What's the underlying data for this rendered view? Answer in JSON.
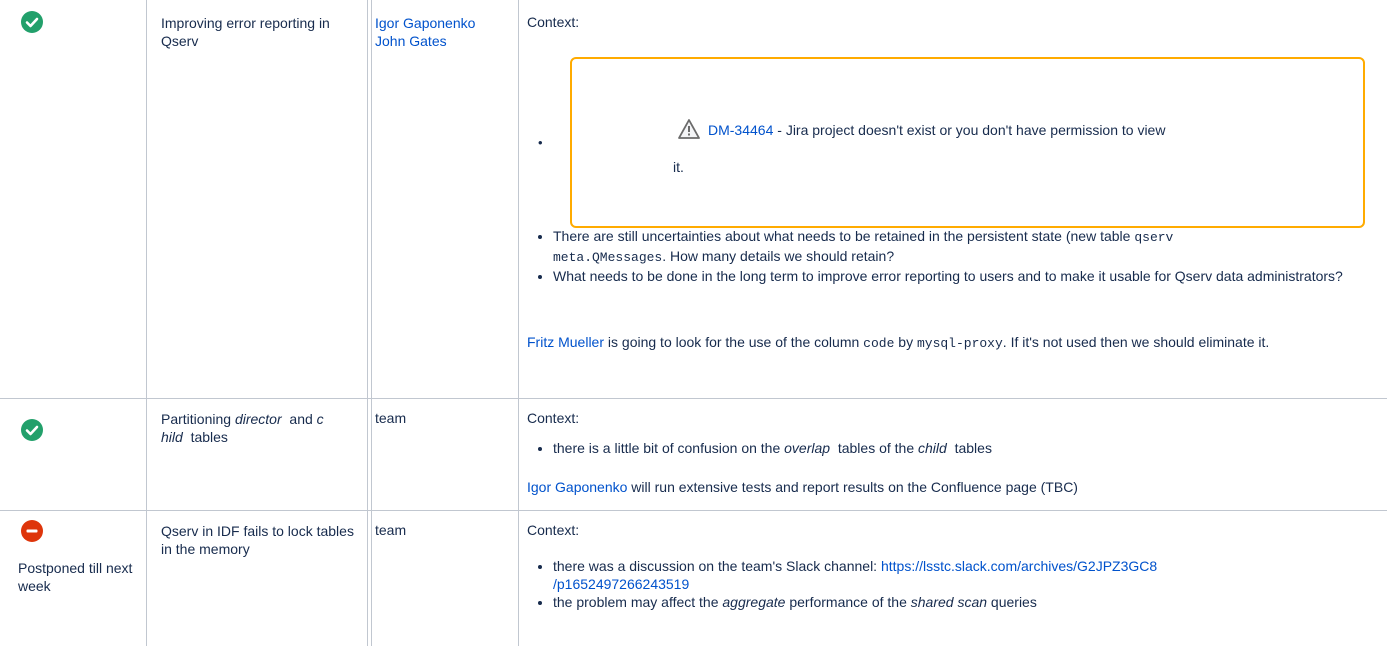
{
  "rows": [
    {
      "status": "check-circle-icon",
      "topic": "Improving error reporting in Qserv",
      "owners": [
        "Igor Gaponenko",
        "John Gates"
      ],
      "context_label": "Context:",
      "jira": {
        "key": "DM-34464",
        "message": " - Jira project doesn't exist or you don't have permission to view",
        "message_end": "it."
      },
      "bullets": [
        {
          "pre": "There are still uncertainties about what needs to be retained in the persistent state (new table ",
          "code1": "qserv",
          "code2": "meta.QMessages",
          "post": ". How many details we should retain?"
        },
        {
          "text": "What needs to be done in the long term to improve error reporting to users and to make it usable for Qserv data administrators?"
        }
      ],
      "action": {
        "person": "Fritz Mueller",
        "t1": " is going to look for the use of the column ",
        "code1": "code",
        "t2": " by ",
        "code2": "mysql-proxy",
        "t3": ". If it's not used then we should eliminate it."
      }
    },
    {
      "status": "check-circle-icon",
      "topic_pre": "Partitioning ",
      "topic_em1": "director",
      "topic_mid": "  and ",
      "topic_em2a": "c",
      "topic_em2b": "hild",
      "topic_post": "  tables",
      "owners": [
        "team"
      ],
      "context_label": "Context:",
      "bullet": {
        "t1": "there is a little bit of confusion on the ",
        "em1": "overlap",
        "t2": "  tables of the ",
        "em2": "child",
        "t3": "  tables"
      },
      "action": {
        "person": "Igor Gaponenko",
        "text": " will run extensive tests and report results on the Confluence page (TBC)"
      }
    },
    {
      "status": "stop-circle-icon",
      "status_note": "Postponed till next week",
      "topic": "Qserv in IDF fails to lock tables in the memory",
      "owners": [
        "team"
      ],
      "context_label": "Context:",
      "bullet1": {
        "text": "there was a discussion on the team's Slack channel: ",
        "link1": "https://lsstc.slack.com/archives/G2JPZ3GC8",
        "link2": "/p1652497266243519"
      },
      "bullet2": {
        "t1": "the problem may affect the ",
        "em1": "aggregate",
        "t2": " performance of the ",
        "em2": "shared scan",
        "t3": " queries"
      }
    }
  ]
}
